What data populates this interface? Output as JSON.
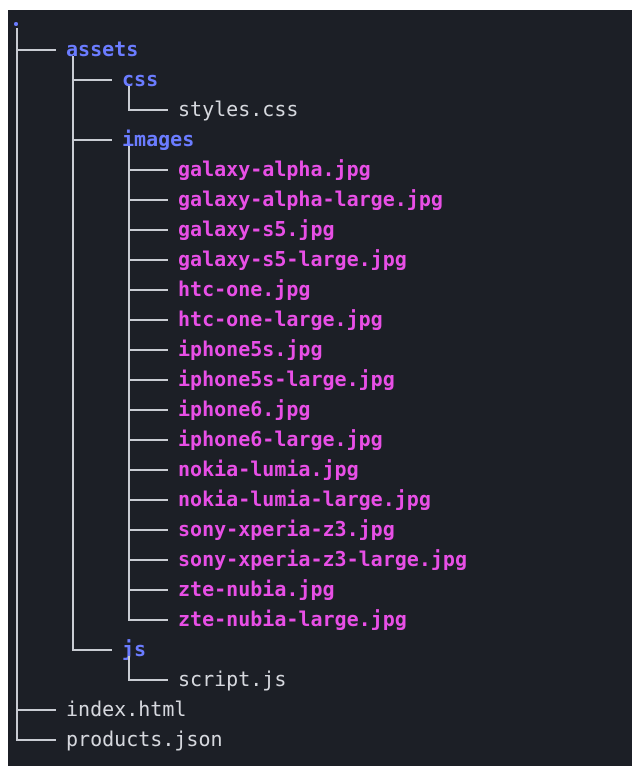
{
  "root": {
    "name": ".",
    "children": [
      {
        "name": "assets",
        "kind": "dir",
        "children": [
          {
            "name": "css",
            "kind": "dir",
            "children": [
              {
                "name": "styles.css",
                "kind": "file"
              }
            ]
          },
          {
            "name": "images",
            "kind": "dir",
            "children": [
              {
                "name": "galaxy-alpha.jpg",
                "kind": "image"
              },
              {
                "name": "galaxy-alpha-large.jpg",
                "kind": "image"
              },
              {
                "name": "galaxy-s5.jpg",
                "kind": "image"
              },
              {
                "name": "galaxy-s5-large.jpg",
                "kind": "image"
              },
              {
                "name": "htc-one.jpg",
                "kind": "image"
              },
              {
                "name": "htc-one-large.jpg",
                "kind": "image"
              },
              {
                "name": "iphone5s.jpg",
                "kind": "image"
              },
              {
                "name": "iphone5s-large.jpg",
                "kind": "image"
              },
              {
                "name": "iphone6.jpg",
                "kind": "image"
              },
              {
                "name": "iphone6-large.jpg",
                "kind": "image"
              },
              {
                "name": "nokia-lumia.jpg",
                "kind": "image"
              },
              {
                "name": "nokia-lumia-large.jpg",
                "kind": "image"
              },
              {
                "name": "sony-xperia-z3.jpg",
                "kind": "image"
              },
              {
                "name": "sony-xperia-z3-large.jpg",
                "kind": "image"
              },
              {
                "name": "zte-nubia.jpg",
                "kind": "image"
              },
              {
                "name": "zte-nubia-large.jpg",
                "kind": "image"
              }
            ]
          },
          {
            "name": "js",
            "kind": "dir",
            "children": [
              {
                "name": "script.js",
                "kind": "file"
              }
            ]
          }
        ]
      },
      {
        "name": "index.html",
        "kind": "file"
      },
      {
        "name": "products.json",
        "kind": "file"
      }
    ]
  },
  "colors": {
    "background": "#1c1f26",
    "directory": "#6b7cff",
    "image": "#e84fe6",
    "file": "#d6d8de",
    "guide": "#c9ccd3"
  }
}
